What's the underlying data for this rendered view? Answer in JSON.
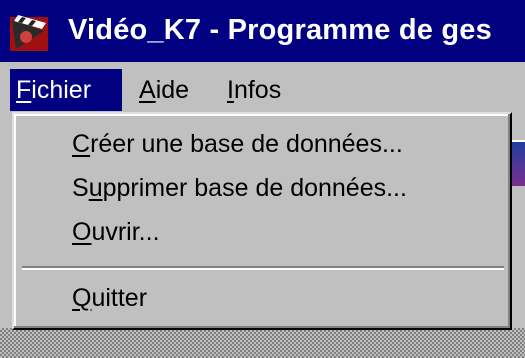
{
  "window": {
    "title": "Vidéo_K7 - Programme de ges",
    "icon": "film-clapper-icon"
  },
  "menubar": {
    "items": [
      {
        "label_ul": "F",
        "label_rest": "ichier",
        "active": true
      },
      {
        "label_ul": "A",
        "label_rest": "ide",
        "active": false
      },
      {
        "label_ul": "I",
        "label_rest": "nfos",
        "active": false
      }
    ]
  },
  "file_menu": {
    "items": [
      {
        "pre": "",
        "ul": "C",
        "post": "réer une base de données..."
      },
      {
        "pre": "S",
        "ul": "u",
        "post": "pprimer base de données..."
      },
      {
        "pre": "",
        "ul": "O",
        "post": "uvrir..."
      },
      {
        "pre": "",
        "ul": "Q",
        "post": "uitter"
      }
    ]
  },
  "colors": {
    "titlebar": "#000080",
    "menu_highlight": "#000080",
    "face": "#c0c0c0"
  }
}
